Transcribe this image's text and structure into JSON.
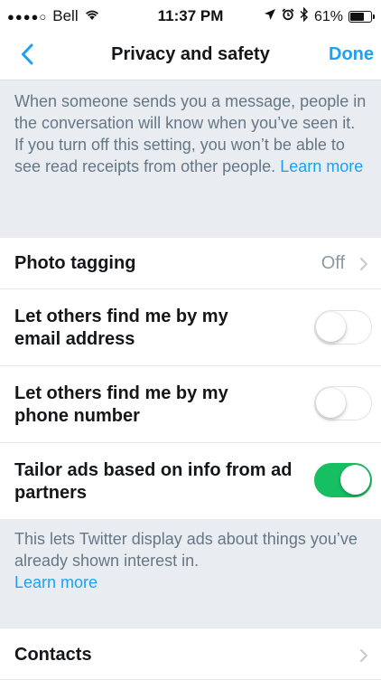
{
  "status_bar": {
    "signal": "●●●●○",
    "carrier": "Bell",
    "wifi_icon": "wifi-icon",
    "time": "11:37 PM",
    "battery_percent": "61%",
    "battery_level": 0.61
  },
  "nav": {
    "title": "Privacy and safety",
    "done_label": "Done"
  },
  "read_receipts_desc": {
    "text": "When someone sends you a message, people in the conversation will know when you’ve seen it. If you turn off this setting, you won’t be able to see read receipts from other people.",
    "link": "Learn more"
  },
  "rows": {
    "photo_tagging": {
      "label": "Photo tagging",
      "value": "Off"
    },
    "find_by_email": {
      "label": "Let others find me by my email address",
      "enabled": false
    },
    "find_by_phone": {
      "label": "Let others find me by my phone number",
      "enabled": false
    },
    "tailor_ads": {
      "label": "Tailor ads based on info from ad partners",
      "enabled": true
    },
    "contacts": {
      "label": "Contacts"
    }
  },
  "ads_desc": {
    "text": "This lets Twitter display ads about things you’ve already shown interest in.",
    "link": "Learn more"
  },
  "colors": {
    "accent": "#1da1f2",
    "toggle_on": "#17bf63",
    "secondary_text": "#657786",
    "background": "#e9ecf0"
  }
}
